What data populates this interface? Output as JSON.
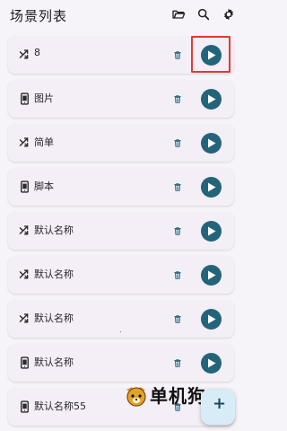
{
  "app": {
    "title": "场景列表",
    "accent_color": "#24647a",
    "highlight_color": "#e3392e"
  },
  "toolbar": {
    "icons": [
      "folder-open-icon",
      "search-icon",
      "settings-icon"
    ]
  },
  "scenes": [
    {
      "label": "8",
      "icon": "shuffle-icon",
      "highlighted": true
    },
    {
      "label": "图片",
      "icon": "phone-icon"
    },
    {
      "label": "简单",
      "icon": "shuffle-icon"
    },
    {
      "label": "脚本",
      "icon": "phone-icon"
    },
    {
      "label": "默认名称",
      "icon": "shuffle-icon"
    },
    {
      "label": "默认名称",
      "icon": "shuffle-icon"
    },
    {
      "label": "默认名称",
      "icon": "shuffle-icon"
    },
    {
      "label": "默认名称",
      "icon": "phone-icon"
    },
    {
      "label": "默认名称55",
      "icon": "phone-icon"
    }
  ],
  "watermark": {
    "text": "单机狗"
  },
  "fab": {
    "icon": "plus-icon",
    "label": "+"
  }
}
